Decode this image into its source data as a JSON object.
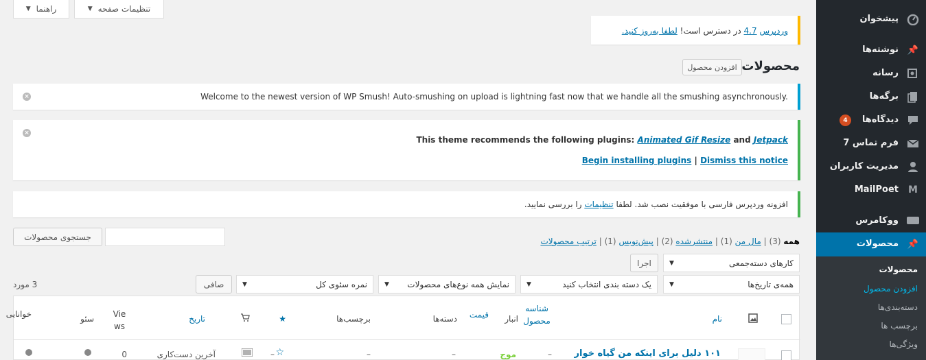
{
  "sidebar": {
    "items": [
      {
        "label": "پیشخوان",
        "icon": "dashboard-icon"
      },
      {
        "label": "نوشته‌ها",
        "icon": "pin-icon"
      },
      {
        "label": "رسانه",
        "icon": "media-icon"
      },
      {
        "label": "برگه‌ها",
        "icon": "pages-icon"
      },
      {
        "label": "دیدگاه‌ها",
        "icon": "comments-icon",
        "badge": "4"
      },
      {
        "label": "فرم تماس 7",
        "icon": "mail-icon"
      },
      {
        "label": "مدیریت کاربران",
        "icon": "user-icon"
      },
      {
        "label": "MailPoet",
        "icon": "mailpoet-icon"
      },
      {
        "label": "ووکامرس",
        "icon": "woo-icon"
      },
      {
        "label": "محصولات",
        "icon": "pin-icon"
      }
    ],
    "submenu": [
      "محصولات",
      "افزودن محصول",
      "دسته‌بندی‌ها",
      "برچسب ها",
      "ویژگی‌ها"
    ]
  },
  "screen": {
    "options": "تنظیمات صفحه",
    "help": "راهنما"
  },
  "notices": {
    "update": {
      "prefix": "وردپرس",
      "version_link": "4.7",
      "middle": "در دسترس است!",
      "update_link": "لطفا به‌روز کنید."
    },
    "smush": "Welcome to the newest version of WP Smush! Auto-smushing on upload is lightning fast now that we handle all the smushing asynchronously.",
    "theme": {
      "intro": "This theme recommends the following plugins:",
      "plugin1": "Animated Gif Resize",
      "and": "and",
      "plugin2": "Jetpack",
      "install": "Begin installing plugins",
      "sep": "|",
      "dismiss": "Dismiss this notice"
    },
    "persian": {
      "before": "افزونه وردپرس فارسی با موفقیت نصب شد. لطفا",
      "link": "تنظیمات",
      "after": "را بررسی نمایید."
    }
  },
  "page": {
    "title": "محصولات",
    "add_new": "افزودن محصول"
  },
  "search": {
    "button": "جستجوی محصولات",
    "value": ""
  },
  "filters_status": {
    "all": "همه",
    "all_count": "(3)",
    "mine": "مال من",
    "mine_count": "(1)",
    "published": "منتشرشده",
    "published_count": "(2)",
    "draft": "پیش‌نویس",
    "draft_count": "(1)",
    "sort": "ترتیب محصولات",
    "sep": "|"
  },
  "bulk": {
    "select": "کارهای دسته‌جمعی",
    "apply": "اجرا"
  },
  "filters": {
    "dates": "همه‌ی تاریخ‌ها",
    "category": "یک دسته بندی انتخاب کنید",
    "type": "نمایش همه نوع‌های محصولات",
    "seo": "نمره سئوی کل",
    "filter_btn": "صافی"
  },
  "count": "3 مورد",
  "table": {
    "headers": {
      "name": "نام",
      "sku": "شناسه محصول",
      "stock": "انبار",
      "price": "قیمت",
      "categories": "دسته‌ها",
      "tags": "برچسب‌ها",
      "date": "تاریخ",
      "views": "Views",
      "seo": "سئو",
      "readability": "خوانایی"
    },
    "row": {
      "name": "۱۰۱ دلیل برای اینکه من گیاه خوار",
      "sku": "–",
      "stock": "موج",
      "price": "–",
      "categories": "–",
      "tags": "–",
      "date": "آخرین دست‌کاری",
      "views": "0"
    }
  },
  "colors": {
    "sidebar": "#23282d",
    "accent": "#0073aa",
    "warning": "#ffb900",
    "info": "#00a0d2",
    "success": "#46b450",
    "badge": "#d54e21"
  }
}
